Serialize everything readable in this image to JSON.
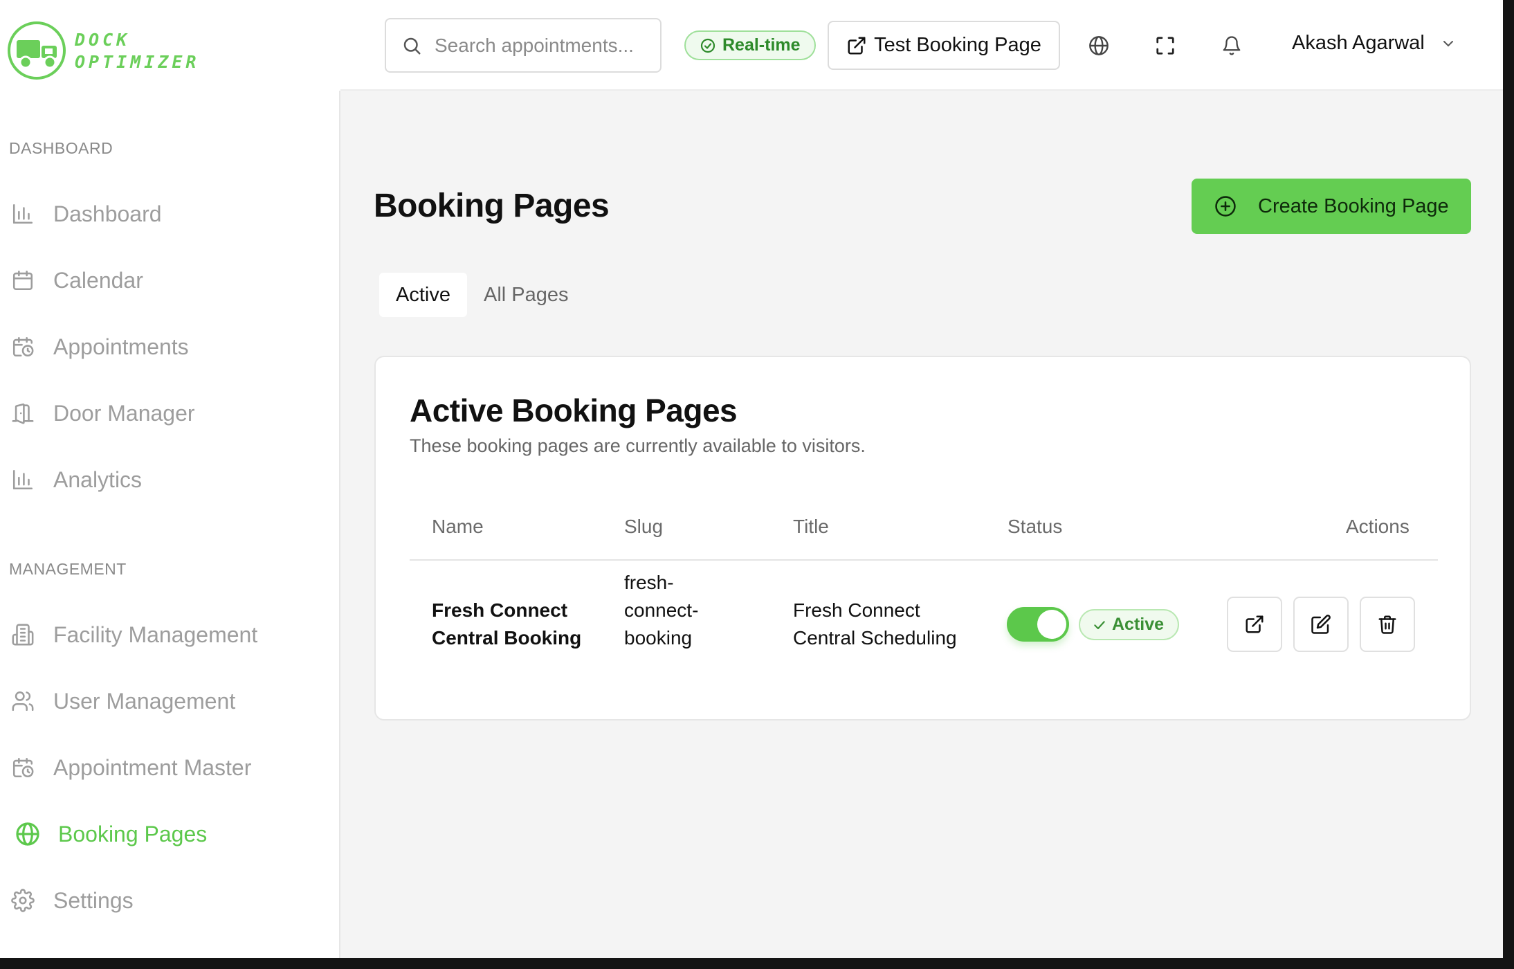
{
  "app": {
    "logo_text_line1": "DOCK",
    "logo_text_line2": "OPTIMIZER",
    "brand_color": "#5cc84b"
  },
  "topbar": {
    "search_placeholder": "Search appointments...",
    "realtime_label": "Real-time",
    "test_booking_label": "Test Booking Page",
    "icons": [
      "globe-icon",
      "fullscreen-icon",
      "bell-icon"
    ],
    "user_name": "Akash Agarwal"
  },
  "sidebar": {
    "section_dashboard": "DASHBOARD",
    "section_management": "MANAGEMENT",
    "items": [
      {
        "label": "Dashboard",
        "icon": "bar-chart-icon",
        "active": false
      },
      {
        "label": "Calendar",
        "icon": "calendar-icon",
        "active": false
      },
      {
        "label": "Appointments",
        "icon": "calendar-clock-icon",
        "active": false
      },
      {
        "label": "Door Manager",
        "icon": "door-icon",
        "active": false
      },
      {
        "label": "Analytics",
        "icon": "bar-chart-icon",
        "active": false
      },
      {
        "label": "Facility Management",
        "icon": "building-icon",
        "active": false
      },
      {
        "label": "User Management",
        "icon": "users-icon",
        "active": false
      },
      {
        "label": "Appointment Master",
        "icon": "calendar-clock-icon",
        "active": false
      },
      {
        "label": "Booking Pages",
        "icon": "globe-icon",
        "active": true
      },
      {
        "label": "Settings",
        "icon": "gear-icon",
        "active": false
      }
    ]
  },
  "main": {
    "title": "Booking Pages",
    "create_button": "Create Booking Page",
    "tabs": [
      {
        "label": "Active",
        "selected": true
      },
      {
        "label": "All Pages",
        "selected": false
      }
    ],
    "card": {
      "title": "Active Booking Pages",
      "subtitle": "These booking pages are currently available to visitors.",
      "columns": [
        "Name",
        "Slug",
        "Title",
        "Status",
        "Actions"
      ],
      "rows": [
        {
          "name_line1": "Fresh Connect",
          "name_line2": "Central Booking",
          "slug_line1": "fresh-",
          "slug_line2": "connect-",
          "slug_line3": "booking",
          "title_line1": "Fresh Connect",
          "title_line2": "Central Scheduling",
          "enabled": true,
          "status": "Active",
          "actions": [
            "external-link-icon",
            "edit-icon",
            "trash-icon"
          ]
        }
      ]
    }
  }
}
